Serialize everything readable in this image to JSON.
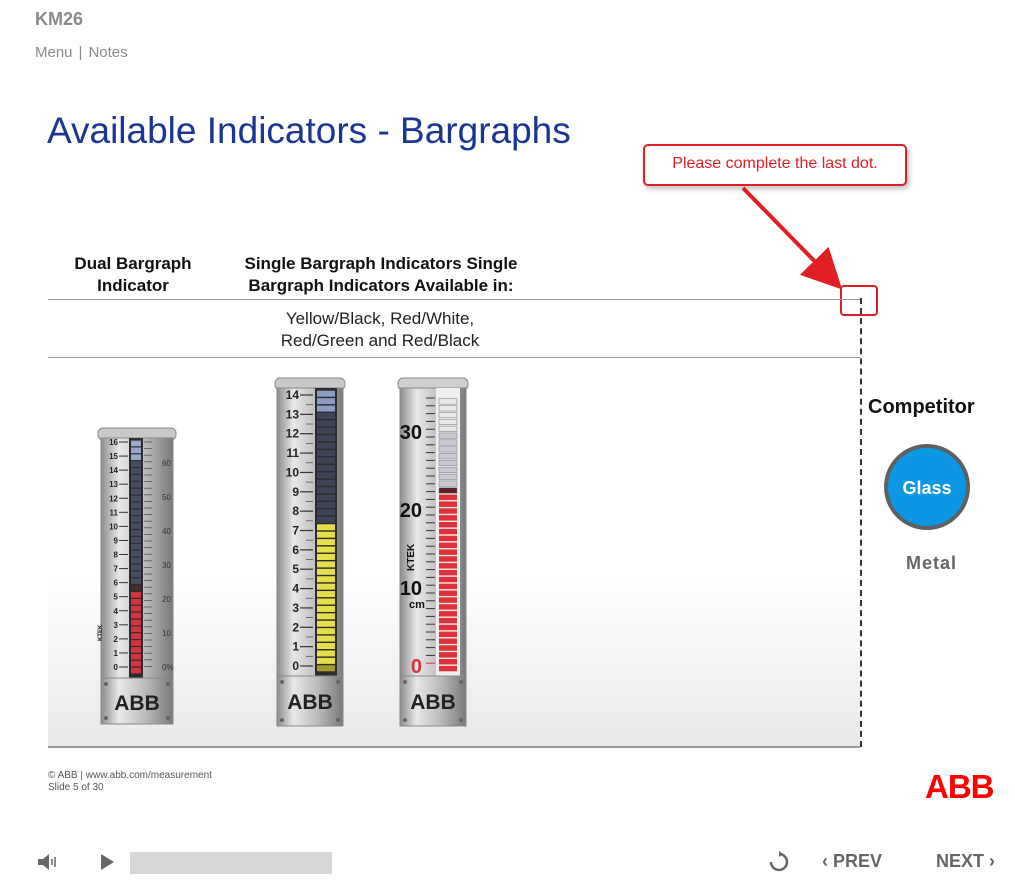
{
  "header": {
    "course_code": "KM26",
    "menu_label": "Menu",
    "separator": "|",
    "notes_label": "Notes"
  },
  "slide": {
    "title": "Available Indicators - Bargraphs",
    "callout_text": "Please complete the last dot.",
    "col1_heading_line1": "Dual Bargraph",
    "col1_heading_line2": "Indicator",
    "col2_heading_line1": "Single Bargraph Indicators Single",
    "col2_heading_line2": "Bargraph Indicators Available in:",
    "colors_line1": "Yellow/Black, Red/White,",
    "colors_line2": "Red/Green and Red/Black",
    "competitor_label": "Competitor",
    "glass_label": "Glass",
    "metal_label": "Metal",
    "accent_color": "#1a3592",
    "alert_color": "#e01f25",
    "button_color": "#0b97e4"
  },
  "indicators": {
    "dual": {
      "left_scale": [
        "16",
        "15",
        "14",
        "13",
        "12",
        "11",
        "10",
        "9",
        "8",
        "7",
        "6",
        "5",
        "4",
        "3",
        "2",
        "1",
        "0"
      ],
      "right_scale": [
        "60",
        "50",
        "40",
        "30",
        "20",
        "10",
        "0%"
      ],
      "brand": "ABB",
      "side_mark": "KTEK"
    },
    "single_yellow": {
      "scale": [
        "14",
        "13",
        "12",
        "11",
        "10",
        "9",
        "8",
        "7",
        "6",
        "5",
        "4",
        "3",
        "2",
        "1",
        "0"
      ],
      "brand": "ABB"
    },
    "single_red": {
      "scale": [
        "30",
        "20",
        "10",
        "0"
      ],
      "unit": "cm",
      "side_mark": "KTEK",
      "brand": "ABB"
    }
  },
  "footer": {
    "copyright": "© ABB | www.abb.com/measurement",
    "slide_counter": "Slide 5 of 30",
    "logo_text": "ABB",
    "logo_color": "#ff0000"
  },
  "player": {
    "volume_icon": "speaker-icon",
    "play_icon": "play-icon",
    "replay_icon": "replay-icon",
    "prev_label": "PREV",
    "next_label": "NEXT"
  }
}
